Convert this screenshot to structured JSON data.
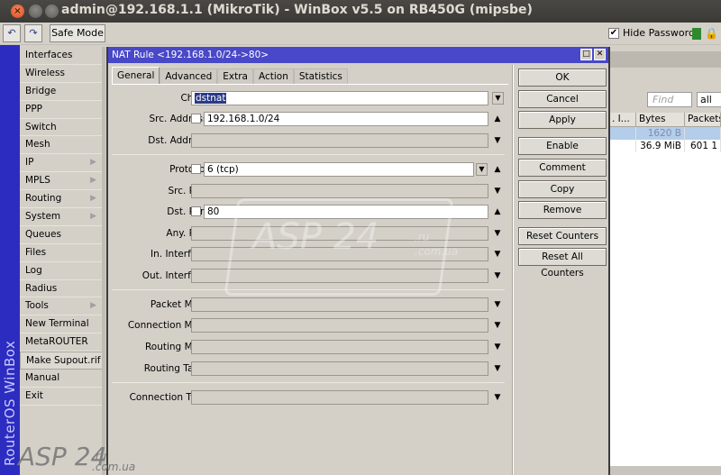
{
  "window": {
    "title": "admin@192.168.1.1 (MikroTik) - WinBox v5.5 on RB450G (mipsbe)",
    "close_glyph": "×"
  },
  "toolbar": {
    "undo_icon": "↶",
    "redo_icon": "↷",
    "safe_mode_label": "Safe Mode",
    "hide_passwords_label": "Hide Passwords",
    "hide_passwords_checked": true,
    "check_glyph": "✔",
    "lock_glyph": "🔒"
  },
  "brand": {
    "vertical_text": "RouterOS WinBox"
  },
  "sidebar": {
    "items": [
      {
        "label": "Interfaces",
        "submenu": false
      },
      {
        "label": "Wireless",
        "submenu": false
      },
      {
        "label": "Bridge",
        "submenu": false
      },
      {
        "label": "PPP",
        "submenu": false
      },
      {
        "label": "Switch",
        "submenu": false
      },
      {
        "label": "Mesh",
        "submenu": false
      },
      {
        "label": "IP",
        "submenu": true
      },
      {
        "label": "MPLS",
        "submenu": true
      },
      {
        "label": "Routing",
        "submenu": true
      },
      {
        "label": "System",
        "submenu": true
      },
      {
        "label": "Queues",
        "submenu": false
      },
      {
        "label": "Files",
        "submenu": false
      },
      {
        "label": "Log",
        "submenu": false
      },
      {
        "label": "Radius",
        "submenu": false
      },
      {
        "label": "Tools",
        "submenu": true
      },
      {
        "label": "New Terminal",
        "submenu": false
      },
      {
        "label": "MetaROUTER",
        "submenu": false
      },
      {
        "label": "Make Supout.rif",
        "submenu": false
      },
      {
        "label": "Manual",
        "submenu": false
      },
      {
        "label": "Exit",
        "submenu": false
      }
    ],
    "submenu_glyph": "▶"
  },
  "background_window": {
    "find_placeholder": "Find",
    "filter_value": "all",
    "columns": [
      ". I...",
      "Bytes",
      "Packets"
    ],
    "rows": [
      {
        "col1": "",
        "bytes": "1620 B",
        "packets": ""
      },
      {
        "col1": "",
        "bytes": "36.9 MiB",
        "packets": "601 1"
      }
    ]
  },
  "dialog": {
    "title": "NAT Rule <192.168.1.0/24->80>",
    "max_glyph": "□",
    "close_glyph": "✕",
    "tabs": [
      "General",
      "Advanced",
      "Extra",
      "Action",
      "Statistics"
    ],
    "active_tab": "General",
    "fields": {
      "chain": {
        "label": "Chain:",
        "value": "dstnat"
      },
      "src_address": {
        "label": "Src. Address:",
        "value": "192.168.1.0/24"
      },
      "dst_address": {
        "label": "Dst. Address:",
        "value": ""
      },
      "protocol": {
        "label": "Protocol:",
        "value": "6 (tcp)"
      },
      "src_port": {
        "label": "Src. Port:",
        "value": ""
      },
      "dst_port": {
        "label": "Dst. Port:",
        "value": "80"
      },
      "any_port": {
        "label": "Any. Port:",
        "value": ""
      },
      "in_interface": {
        "label": "In. Interface:",
        "value": ""
      },
      "out_interface": {
        "label": "Out. Interface:",
        "value": ""
      },
      "packet_mark": {
        "label": "Packet Mark:",
        "value": ""
      },
      "connection_mark": {
        "label": "Connection Mark:",
        "value": ""
      },
      "routing_mark": {
        "label": "Routing Mark:",
        "value": ""
      },
      "routing_table": {
        "label": "Routing Table:",
        "value": ""
      },
      "connection_type": {
        "label": "Connection Type:",
        "value": ""
      }
    },
    "glyphs": {
      "up": "▲",
      "down": "▼",
      "dropdown": "⯯"
    },
    "buttons": {
      "ok": "OK",
      "cancel": "Cancel",
      "apply": "Apply",
      "enable": "Enable",
      "comment": "Comment",
      "copy": "Copy",
      "remove": "Remove",
      "reset_counters": "Reset Counters",
      "reset_all_counters": "Reset All Counters"
    }
  },
  "watermark": {
    "text": "ASP 24",
    "suffix_top": ".ru",
    "suffix_bottom": ".com.ua"
  }
}
